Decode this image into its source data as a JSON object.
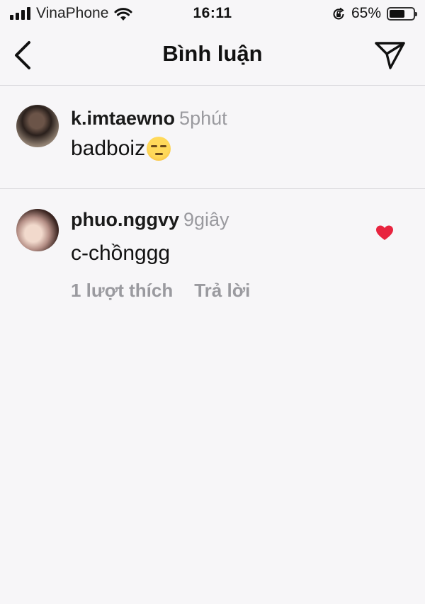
{
  "status_bar": {
    "carrier": "VinaPhone",
    "time": "16:11",
    "battery_percent": "65%",
    "battery_level": 0.65,
    "icons": [
      "signal-icon",
      "wifi-icon",
      "rotation-lock-icon",
      "battery-icon"
    ]
  },
  "header": {
    "title": "Bình luận",
    "back_icon": "chevron-left-icon",
    "send_icon": "send-icon"
  },
  "comments": [
    {
      "username": "k.imtaewno",
      "time": "5phút",
      "text": "badboiz",
      "emoji": "unamused-face-emoji",
      "liked": false
    },
    {
      "username": "phuo.nggvy",
      "time": "9giây",
      "text": "c-chồnggg",
      "likes_label": "1 lượt thích",
      "reply_label": "Trả lời",
      "liked": true
    }
  ],
  "colors": {
    "background": "#f7f6f8",
    "heart": "#e8243f",
    "muted_text": "#9a9a9f",
    "divider": "#d9d8dc"
  }
}
